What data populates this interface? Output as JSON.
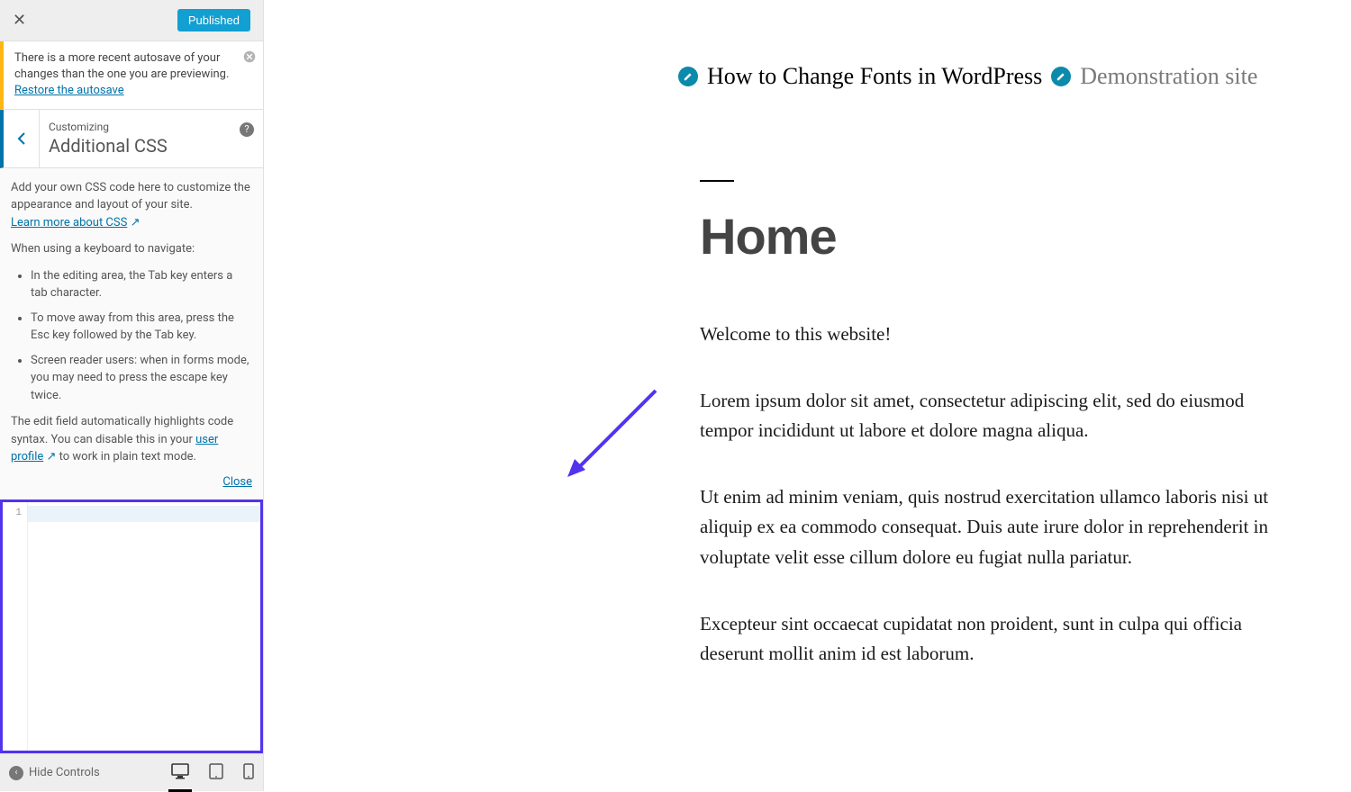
{
  "header": {
    "published_label": "Published"
  },
  "notice": {
    "text": "There is a more recent autosave of your changes than the one you are previewing. ",
    "restore_link": "Restore the autosave"
  },
  "section": {
    "overline": "Customizing",
    "title": "Additional CSS"
  },
  "description": {
    "intro": "Add your own CSS code here to customize the appearance and layout of your site.",
    "learn_more_link": "Learn more about CSS",
    "para2": "When using a keyboard to navigate:",
    "li1": "In the editing area, the Tab key enters a tab character.",
    "li2": "To move away from this area, press the Esc key followed by the Tab key.",
    "li3": "Screen reader users: when in forms mode, you may need to press the escape key twice.",
    "para3_pre": "The edit field automatically highlights code syntax. You can disable this in your ",
    "userprofile_link": "user profile",
    "para3_post": " to work in plain text mode.",
    "close_link": "Close"
  },
  "editor": {
    "line_number": "1"
  },
  "footer": {
    "hide_controls": "Hide Controls"
  },
  "preview": {
    "site_title": "How to Change Fonts in WordPress",
    "tagline": "Demonstration site",
    "page_title": "Home",
    "para1": "Welcome to this website!",
    "para2": "Lorem ipsum dolor sit amet, consectetur adipiscing elit, sed do eiusmod tempor incididunt ut labore et dolore magna aliqua.",
    "para3": "Ut enim ad minim veniam, quis nostrud exercitation ullamco laboris nisi ut aliquip ex ea commodo consequat. Duis aute irure dolor in reprehenderit in voluptate velit esse cillum dolore eu fugiat nulla pariatur.",
    "para4": "Excepteur sint occaecat cupidatat non proident, sunt in culpa qui officia deserunt mollit anim id est laborum."
  }
}
